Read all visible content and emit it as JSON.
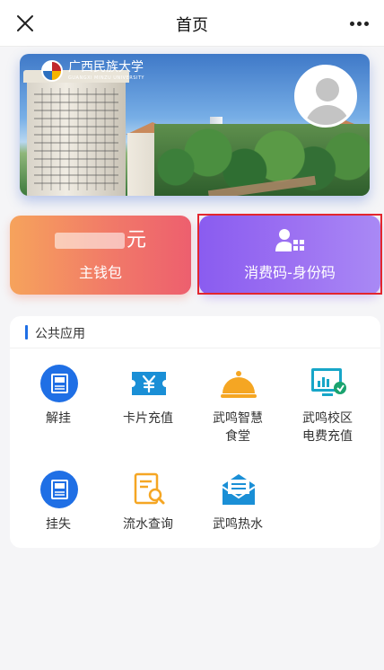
{
  "topbar": {
    "title": "首页",
    "close_icon": "close-icon",
    "more_icon": "more-icon"
  },
  "banner": {
    "logo_text": "广西民族大学",
    "logo_subtext": "GUANGXI MINZU UNIVERSITY"
  },
  "wallet_card": {
    "unit": "元",
    "label": "主钱包"
  },
  "code_card": {
    "label": "消费码-身份码",
    "icon": "qr-id-icon"
  },
  "section": {
    "title": "公共应用",
    "apps": [
      {
        "label": "解挂",
        "icon": "unfreeze-icon",
        "color": "#1f6fe5"
      },
      {
        "label": "卡片充值",
        "icon": "yen-ticket-icon",
        "color": "#1a8fd6"
      },
      {
        "label": "武鸣智慧\n食堂",
        "icon": "dish-cover-icon",
        "color": "#f5a623"
      },
      {
        "label": "武鸣校区\n电费充值",
        "icon": "electricity-chart-icon",
        "color": "#17a6c8"
      },
      {
        "label": "挂失",
        "icon": "report-loss-icon",
        "color": "#1f6fe5"
      },
      {
        "label": "流水查询",
        "icon": "transaction-search-icon",
        "color": "#f5a623"
      },
      {
        "label": "武鸣热水",
        "icon": "hot-water-icon",
        "color": "#1a8fd6"
      }
    ]
  }
}
